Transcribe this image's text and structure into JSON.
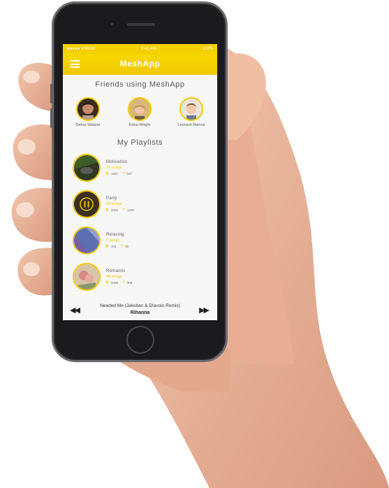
{
  "statusbar": {
    "carrier": "●●●●● VIRGIN",
    "time": "9:41 AM",
    "battery": "100%"
  },
  "app": {
    "title": "MeshApp"
  },
  "friends_section": {
    "title": "Friends using MeshApp",
    "friends": [
      {
        "name": "Debra Watson"
      },
      {
        "name": "Edna Wright"
      },
      {
        "name": "Leonard Ramos"
      }
    ]
  },
  "playlists_section": {
    "title": "My Playlists",
    "playlists": [
      {
        "name": "Motivation",
        "songs": "16 songs",
        "plays": "1257",
        "likes": "667"
      },
      {
        "name": "Party",
        "songs": "29 songs",
        "plays": "2559",
        "likes": "1246"
      },
      {
        "name": "Relaxing",
        "songs": "7 songs",
        "plays": "134",
        "likes": "35"
      },
      {
        "name": "Romantic",
        "songs": "48 songs",
        "plays": "2308",
        "likes": "809"
      }
    ]
  },
  "player": {
    "track": "Needed Me (Jakoban & D!avolo Remix)",
    "artist": "Rihanna"
  },
  "colors": {
    "accent": "#f2c800",
    "screen_bg": "#f7f7f7",
    "phone_body": "#1b1b1d"
  }
}
